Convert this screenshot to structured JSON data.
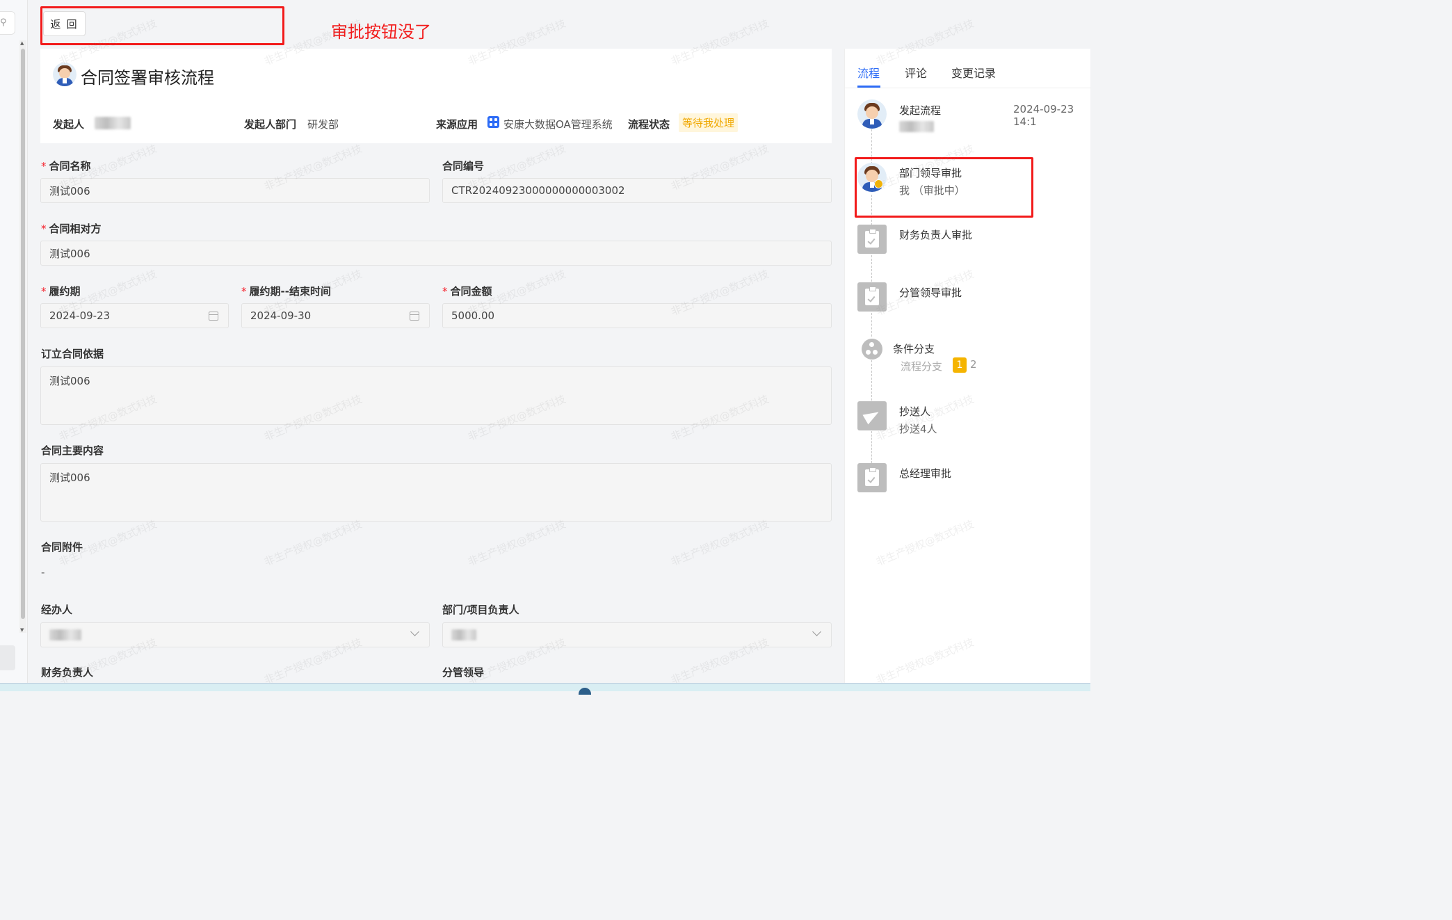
{
  "toolbar": {
    "back_label": "返 回"
  },
  "annotation": {
    "text": "审批按钮没了",
    "color": "#f21b1b"
  },
  "header": {
    "title": "合同签署审核流程",
    "initiator_label": "发起人",
    "dept_label": "发起人部门",
    "dept_value": "研发部",
    "source_label": "来源应用",
    "source_value": "安康大数据OA管理系统",
    "status_label": "流程状态",
    "status_value": "等待我处理"
  },
  "form": {
    "contract_name": {
      "label": "合同名称",
      "value": "测试006"
    },
    "contract_no": {
      "label": "合同编号",
      "value": "CTR20240923000000000003002"
    },
    "counterparty": {
      "label": "合同相对方",
      "value": "测试006"
    },
    "period_start": {
      "label": "履约期",
      "value": "2024-09-23"
    },
    "period_end": {
      "label": "履约期--结束时间",
      "value": "2024-09-30"
    },
    "amount": {
      "label": "合同金额",
      "value": "5000.00"
    },
    "basis": {
      "label": "订立合同依据",
      "value": "测试006"
    },
    "content": {
      "label": "合同主要内容",
      "value": "测试006"
    },
    "attachment": {
      "label": "合同附件",
      "value": "-"
    },
    "handler": {
      "label": "经办人"
    },
    "dept_head": {
      "label": "部门/项目负责人"
    },
    "finance_head": {
      "label": "财务负责人"
    },
    "leader": {
      "label": "分管领导"
    }
  },
  "right_panel": {
    "tabs": [
      "流程",
      "评论",
      "变更记录"
    ],
    "active_tab": "流程",
    "steps": [
      {
        "title": "发起流程",
        "time": "2024-09-23 14:1"
      },
      {
        "title": "部门领导审批",
        "sub": "我 （审批中）"
      },
      {
        "title": "财务负责人审批"
      },
      {
        "title": "分管领导审批"
      },
      {
        "title": "条件分支",
        "sub": "流程分支",
        "badges": [
          "1",
          "2"
        ]
      },
      {
        "title": "抄送人",
        "sub": "抄送4人"
      },
      {
        "title": "总经理审批"
      }
    ]
  },
  "watermark": "非生产授权@数式科技",
  "colors": {
    "accent": "#2d6cf6",
    "warning": "#f0a800",
    "annotation": "#f21b1b"
  }
}
